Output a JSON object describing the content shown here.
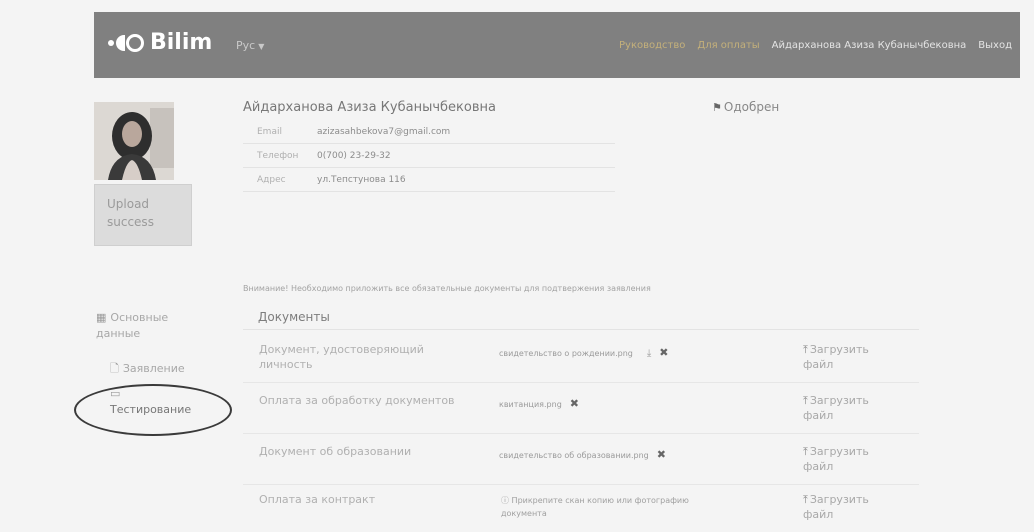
{
  "navbar": {
    "brand": "Bilim",
    "lang": "Рус",
    "links": [
      {
        "label": "Руководство",
        "dim": true
      },
      {
        "label": "Для оплаты",
        "dim": true
      },
      {
        "label": "Айдарханова Азиза Кубанычбековна",
        "dim": false
      },
      {
        "label": "Выход",
        "dim": false
      }
    ]
  },
  "profile": {
    "upload_line1": "Upload",
    "upload_line2": "success",
    "fullname": "Айдарханова Азиза Кубанычбековна",
    "status": "Одобрен",
    "fields": [
      {
        "label": "Email",
        "value": "azizasahbekova7@gmail.com"
      },
      {
        "label": "Телефон",
        "value": "0(700) 23-29-32"
      },
      {
        "label": "Адрес",
        "value": "ул.Тепстунова 116"
      }
    ]
  },
  "sidebar": {
    "items": [
      {
        "label_line1": "Основные",
        "label_line2": "данные",
        "icon": "id-card-icon"
      },
      {
        "label": "Заявление",
        "icon": "file-icon"
      },
      {
        "label": "Тестирование",
        "icon": "monitor-icon"
      }
    ]
  },
  "documents": {
    "notice": "Внимание! Необходимо приложить все обязательные документы для подтвержения заявления",
    "title": "Документы",
    "rows": [
      {
        "name": "Документ, удостоверяющий личность",
        "file": "свидетельство о рождении.png",
        "download": true,
        "remove": true,
        "upload_line1": "Загрузить",
        "upload_line2": "файл"
      },
      {
        "name": "Оплата за обработку документов",
        "file": "квитанция.png",
        "download": false,
        "remove": true,
        "upload_line1": "Загрузить",
        "upload_line2": "файл"
      },
      {
        "name": "Документ об образовании",
        "file": "свидетельство об образовании.png",
        "download": false,
        "remove": true,
        "upload_line1": "Загрузить",
        "upload_line2": "файл"
      },
      {
        "name": "Оплата за контракт",
        "hint": "Прикрепите скан копию или фотографию документа",
        "upload_line1": "Загрузить",
        "upload_line2": "файл"
      }
    ]
  }
}
